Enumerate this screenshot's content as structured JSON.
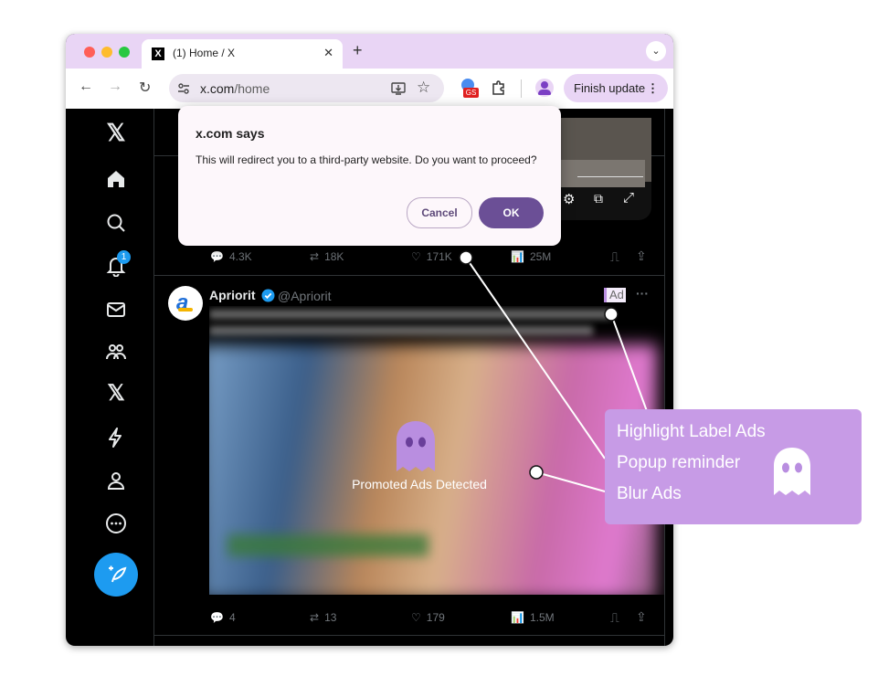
{
  "browser": {
    "tab_title": "(1) Home / X",
    "tab_favicon": "X",
    "url_host": "x.com",
    "url_path": "/home",
    "finish_update_label": "Finish update",
    "extension_badge": "GS"
  },
  "rail": {
    "notification_count": "1"
  },
  "dialog": {
    "title": "x.com says",
    "message": "This will redirect you to a third-party website. Do you want to proceed?",
    "cancel_label": "Cancel",
    "ok_label": "OK"
  },
  "top_tweet": {
    "replies": "4.3K",
    "reposts": "18K",
    "likes": "171K",
    "views": "25M"
  },
  "ad_tweet": {
    "author": "Apriorit",
    "handle": "@Apriorit",
    "ad_label": "Ad",
    "overlay_text": "Promoted Ads Detected",
    "replies": "4",
    "reposts": "13",
    "likes": "179",
    "views": "1.5M"
  },
  "callout": {
    "line1": "Highlight Label Ads",
    "line2": "Popup reminder",
    "line3": "Blur Ads",
    "accent_color": "#c79be6"
  }
}
